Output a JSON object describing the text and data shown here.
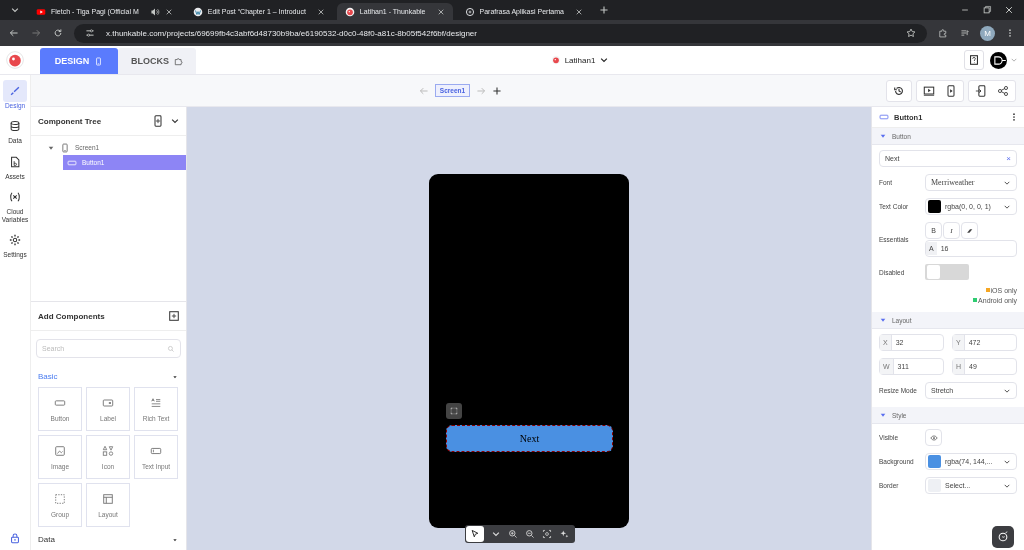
{
  "browser": {
    "tabs": [
      {
        "title": "Fletch - Tiga Pagi (Official M",
        "selected": false,
        "kind": "video",
        "audio": true
      },
      {
        "title": "Edit Post “Chapter 1 – Introduct",
        "selected": false,
        "kind": "wordpress",
        "audio": false
      },
      {
        "title": "Latihan1 - Thunkable",
        "selected": true,
        "kind": "thunkable",
        "audio": false
      },
      {
        "title": "Parafrasa Aplikasi Pertama",
        "selected": false,
        "kind": "chat",
        "audio": false
      }
    ],
    "url": "x.thunkable.com/projects/69699fb4c3abf6d48730b9ba/e6190532-d0c0-48f0-a81c-8b05f542f6bf/designer",
    "avatar": "M"
  },
  "app": {
    "modes": [
      {
        "label": "DESIGN",
        "selected": true
      },
      {
        "label": "BLOCKS",
        "selected": false
      }
    ],
    "project": "Latihan1",
    "screen": "Screen1"
  },
  "rail": [
    {
      "label": "Design",
      "selected": true,
      "kind": "brush"
    },
    {
      "label": "Data",
      "selected": false,
      "kind": "database"
    },
    {
      "label": "Assets",
      "selected": false,
      "kind": "file"
    },
    {
      "label": "Cloud Variables",
      "selected": false,
      "kind": "variable"
    },
    {
      "label": "Settings",
      "selected": false,
      "kind": "gear"
    }
  ],
  "component_tree": {
    "title": "Component Tree",
    "items": [
      {
        "label": "Screen1",
        "expanded": true,
        "selected": false,
        "children": [
          {
            "label": "Button1",
            "selected": true
          }
        ]
      }
    ]
  },
  "add_components": {
    "title": "Add Components",
    "search": {
      "placeholder": "Search"
    },
    "categories": [
      {
        "label": "Basic",
        "expanded": true,
        "items": [
          {
            "label": "Button",
            "kind": "button"
          },
          {
            "label": "Label",
            "kind": "label"
          },
          {
            "label": "Rich Text",
            "kind": "richtext"
          },
          {
            "label": "Image",
            "kind": "image"
          },
          {
            "label": "Icon",
            "kind": "icon"
          },
          {
            "label": "Text Input",
            "kind": "input"
          },
          {
            "label": "Group",
            "kind": "group"
          },
          {
            "label": "Layout",
            "kind": "layout"
          }
        ]
      },
      {
        "label": "Data",
        "expanded": false
      }
    ]
  },
  "canvas": {
    "button": "Next"
  },
  "properties": {
    "title": "Button1",
    "sections": [
      {
        "title": "Button",
        "expanded": true,
        "rows": [
          {
            "kind": "text",
            "value": "Next",
            "clear": "×"
          },
          {
            "kind": "select",
            "label": "Font",
            "value": "Merriweather"
          },
          {
            "kind": "color",
            "label": "Text Color",
            "color": "#000000",
            "value": "rgba(0, 0, 0, 1)"
          },
          {
            "kind": "essentials",
            "label": "Essentials",
            "bold": "B",
            "italic": "I",
            "size_icon": "A",
            "size": "16"
          },
          {
            "kind": "toggle",
            "label": "Disabled",
            "on": false
          },
          {
            "kind": "notes",
            "notes": [
              {
                "text": "iOS only",
                "color": "#f5a623"
              },
              {
                "text": "Android only",
                "color": "#2ecc71"
              }
            ]
          }
        ]
      },
      {
        "title": "Layout",
        "expanded": true,
        "rows": [
          {
            "kind": "pair",
            "fields": [
              {
                "label": "X",
                "value": "32"
              },
              {
                "label": "Y",
                "value": "472"
              }
            ]
          },
          {
            "kind": "pair",
            "fields": [
              {
                "label": "W",
                "value": "311"
              },
              {
                "label": "H",
                "value": "49"
              }
            ]
          },
          {
            "kind": "select",
            "label": "Resize Mode",
            "value": "Stretch"
          }
        ]
      },
      {
        "title": "Style",
        "expanded": true,
        "rows": [
          {
            "kind": "eye",
            "label": "Visible"
          },
          {
            "kind": "color",
            "label": "Background",
            "color": "#4a90e2",
            "value": "rgba(74, 144,..."
          },
          {
            "kind": "color",
            "label": "Border",
            "color": "#eef0f4",
            "value": "Select..."
          }
        ]
      }
    ]
  }
}
